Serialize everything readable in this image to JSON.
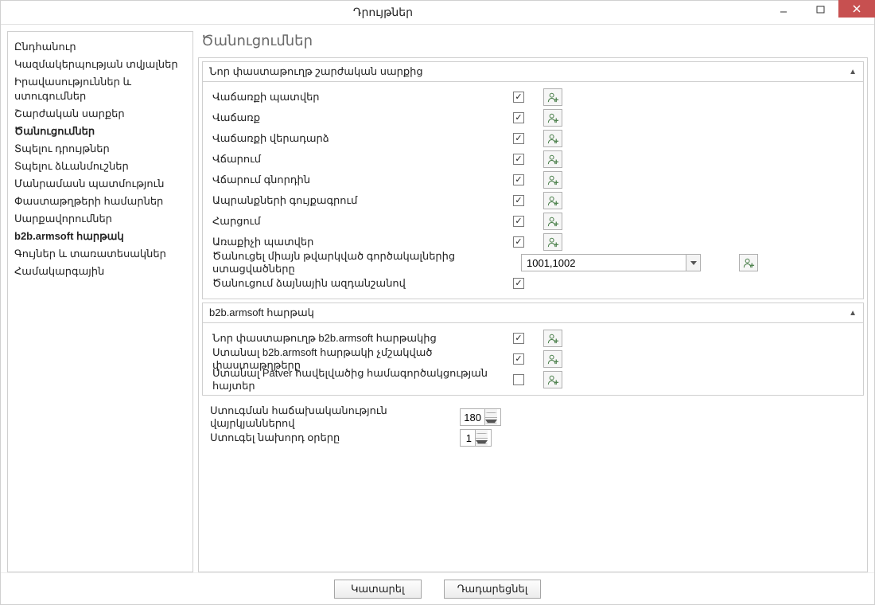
{
  "window": {
    "title": "Դրույթներ"
  },
  "sidebar": {
    "items": [
      {
        "label": "Ընդհանուր"
      },
      {
        "label": "Կազմակերպության տվյալներ"
      },
      {
        "label": "Իրավասություններ և ստուգումներ"
      },
      {
        "label": "Շարժական սարքեր"
      },
      {
        "label": "Ծանուցումներ",
        "selected": true
      },
      {
        "label": "Տպելու դրույթներ"
      },
      {
        "label": "Տպելու ձևանմուշներ"
      },
      {
        "label": "Մանրամասն պատմություն"
      },
      {
        "label": "Փաստաթղթերի համարներ"
      },
      {
        "label": "Սարքավորումներ"
      },
      {
        "label": "b2b.armsoft հարթակ",
        "bold": true
      },
      {
        "label": "Գույներ և տառատեսակներ"
      },
      {
        "label": "Համակարգային"
      }
    ]
  },
  "main": {
    "heading": "Ծանուցումներ",
    "group1": {
      "title": "Նոր փաստաթուղթ շարժական սարքից",
      "rows": [
        {
          "label": "Վաճառքի պատվեր",
          "checked": true
        },
        {
          "label": "Վաճառք",
          "checked": true
        },
        {
          "label": "Վաճառքի վերադարձ",
          "checked": true
        },
        {
          "label": "Վճարում",
          "checked": true
        },
        {
          "label": "Վճարում գնորդին",
          "checked": true
        },
        {
          "label": "Ապրանքների գույքագրում",
          "checked": true
        },
        {
          "label": "Հարցում",
          "checked": true
        },
        {
          "label": "Առաքիչի պատվեր",
          "checked": true
        }
      ],
      "combo_label": "Ծանուցել միայն թվարկված գործակալներից ստացվածները",
      "combo_value": "1001,1002",
      "sound_label": "Ծանուցում ձայնային ազդանշանով",
      "sound_checked": true
    },
    "group2": {
      "title": "b2b.armsoft հարթակ",
      "rows": [
        {
          "label": "Նոր փաստաթուղթ b2b.armsoft հարթակից",
          "checked": true
        },
        {
          "label": "Ստանալ b2b.armsoft հարթակի չմշակված փաստաթղթերը",
          "checked": true
        },
        {
          "label": "Ստանալ Patver հավելվածից համագործակցության հայտեր",
          "checked": false
        }
      ]
    },
    "freq_label": "Ստուգման հաճախականություն վայրկյաններով",
    "freq_value": "180",
    "days_label": "Ստուգել նախորդ օրերը",
    "days_value": "1"
  },
  "footer": {
    "ok": "Կատարել",
    "cancel": "Դադարեցնել"
  }
}
